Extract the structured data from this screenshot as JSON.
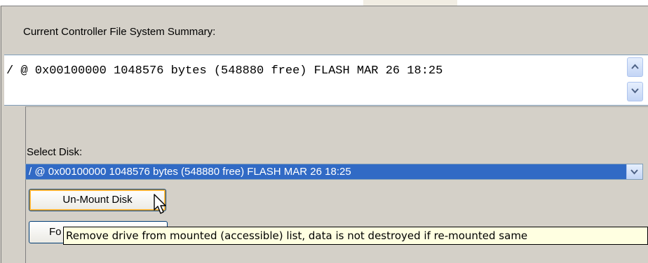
{
  "summary": {
    "label": "Current Controller File System Summary:",
    "text": "/ @ 0x00100000 1048576 bytes (548880 free) FLASH MAR 26 18:25"
  },
  "disk": {
    "label": "Select Disk:",
    "selected": "/ @ 0x00100000 1048576 bytes (548880 free) FLASH MAR 26 18:25"
  },
  "buttons": {
    "unmount": "Un-Mount Disk",
    "format_partial": "Fo"
  },
  "tooltip": {
    "text": "Remove drive from mounted (accessible) list, data is not destroyed if re-mounted same"
  },
  "colors": {
    "selection": "#316ac5",
    "tooltip_bg": "#ffffe1",
    "focus_ring": "#f8b33c"
  },
  "icons": {
    "scroll_up": "chevron-up-icon",
    "scroll_down": "chevron-down-icon",
    "dropdown": "chevron-down-icon",
    "cursor": "mouse-pointer-icon"
  }
}
